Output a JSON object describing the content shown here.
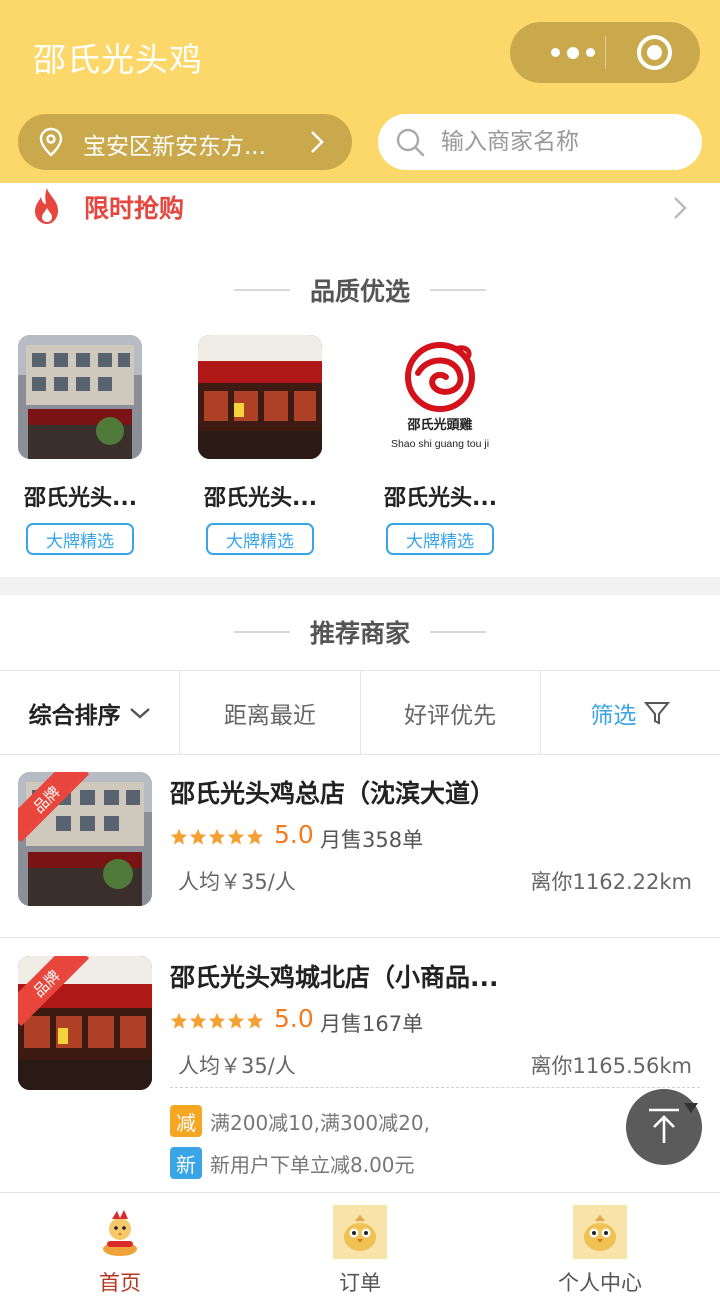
{
  "header": {
    "title": "邵氏光头鸡",
    "location_text": "宝安区新安东方...",
    "search_placeholder": "输入商家名称"
  },
  "flash_sale": {
    "label": "限时抢购"
  },
  "quality": {
    "title": "品质优选",
    "items": [
      {
        "name": "邵氏光头...",
        "tag": "大牌精选"
      },
      {
        "name": "邵氏光头...",
        "tag": "大牌精选"
      },
      {
        "name": "邵氏光头...",
        "tag": "大牌精选"
      }
    ],
    "logo_text": "Shao shi guang tou ji",
    "logo_cn": "邵氏光頭雞"
  },
  "recommend": {
    "title": "推荐商家",
    "sort_tabs": [
      "综合排序",
      "距离最近",
      "好评优先",
      "筛选"
    ],
    "stores": [
      {
        "badge": "品牌",
        "name": "邵氏光头鸡总店（沈滨大道）",
        "score": "5.0",
        "rating": 5,
        "sales": "月售358单",
        "avg": "人均￥35/人",
        "distance": "离你1162.22km"
      },
      {
        "badge": "品牌",
        "name": "邵氏光头鸡城北店（小商品...",
        "score": "5.0",
        "rating": 5,
        "sales": "月售167单",
        "avg": "人均￥35/人",
        "distance": "离你1165.56km",
        "promos": [
          {
            "chip": "减",
            "text": "满200减10,满300减20,",
            "color": "#f5a623"
          },
          {
            "chip": "新",
            "text": "新用户下单立减8.00元",
            "color": "#3aa5e6"
          }
        ]
      }
    ]
  },
  "tabbar": {
    "items": [
      {
        "label": "首页",
        "active": true
      },
      {
        "label": "订单",
        "active": false
      },
      {
        "label": "个人中心",
        "active": false
      }
    ]
  },
  "colors": {
    "header": "#fcd86a",
    "accent_red": "#e5473f",
    "accent_blue": "#3aa5e6",
    "score_orange": "#f07c22"
  }
}
